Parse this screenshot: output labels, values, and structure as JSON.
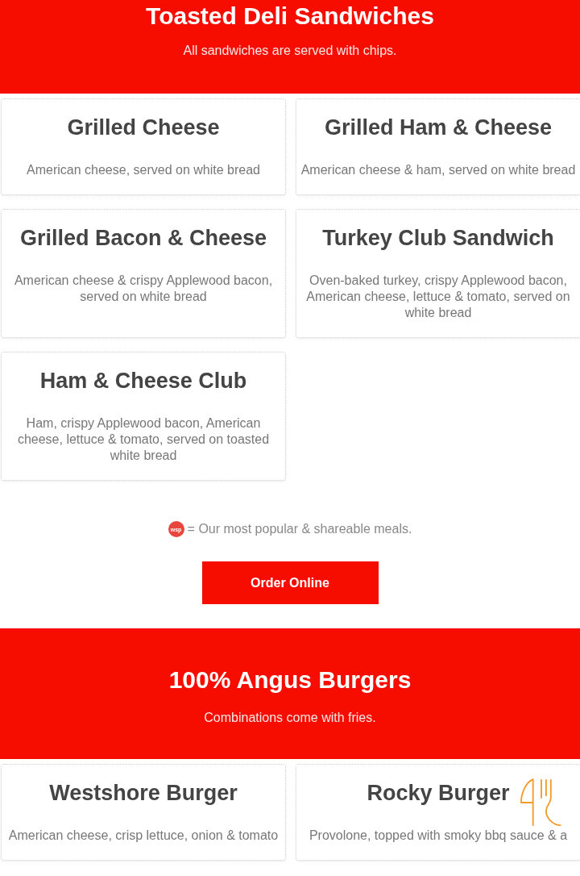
{
  "sections": [
    {
      "title": "Toasted Deli Sandwiches",
      "subtitle": "All sandwiches are served with chips.",
      "items": [
        {
          "name": "Grilled Cheese",
          "description": "American cheese, served on white bread"
        },
        {
          "name": "Grilled Ham & Cheese",
          "description": "American cheese & ham, served on white bread"
        },
        {
          "name": "Grilled Bacon & Cheese",
          "description": "American cheese & crispy Applewood bacon, served on white bread"
        },
        {
          "name": "Turkey Club Sandwich",
          "description": "Oven-baked turkey, crispy Applewood bacon, American cheese, lettuce & tomato, served on white bread"
        },
        {
          "name": "Ham & Cheese Club",
          "description": "Ham, crispy Applewood bacon, American cheese, lettuce & tomato, served on toasted white bread"
        }
      ],
      "legend": {
        "badge": "wsp",
        "text": "= Our most popular & shareable meals."
      },
      "button": "Order Online"
    },
    {
      "title": "100% Angus Burgers",
      "subtitle": "Combinations come with fries.",
      "items": [
        {
          "name": "Westshore Burger",
          "description": "American cheese, crisp lettuce, onion & tomato"
        },
        {
          "name": "Rocky Burger",
          "description": "Provolone, topped with smoky bbq sauce & a"
        }
      ]
    }
  ]
}
